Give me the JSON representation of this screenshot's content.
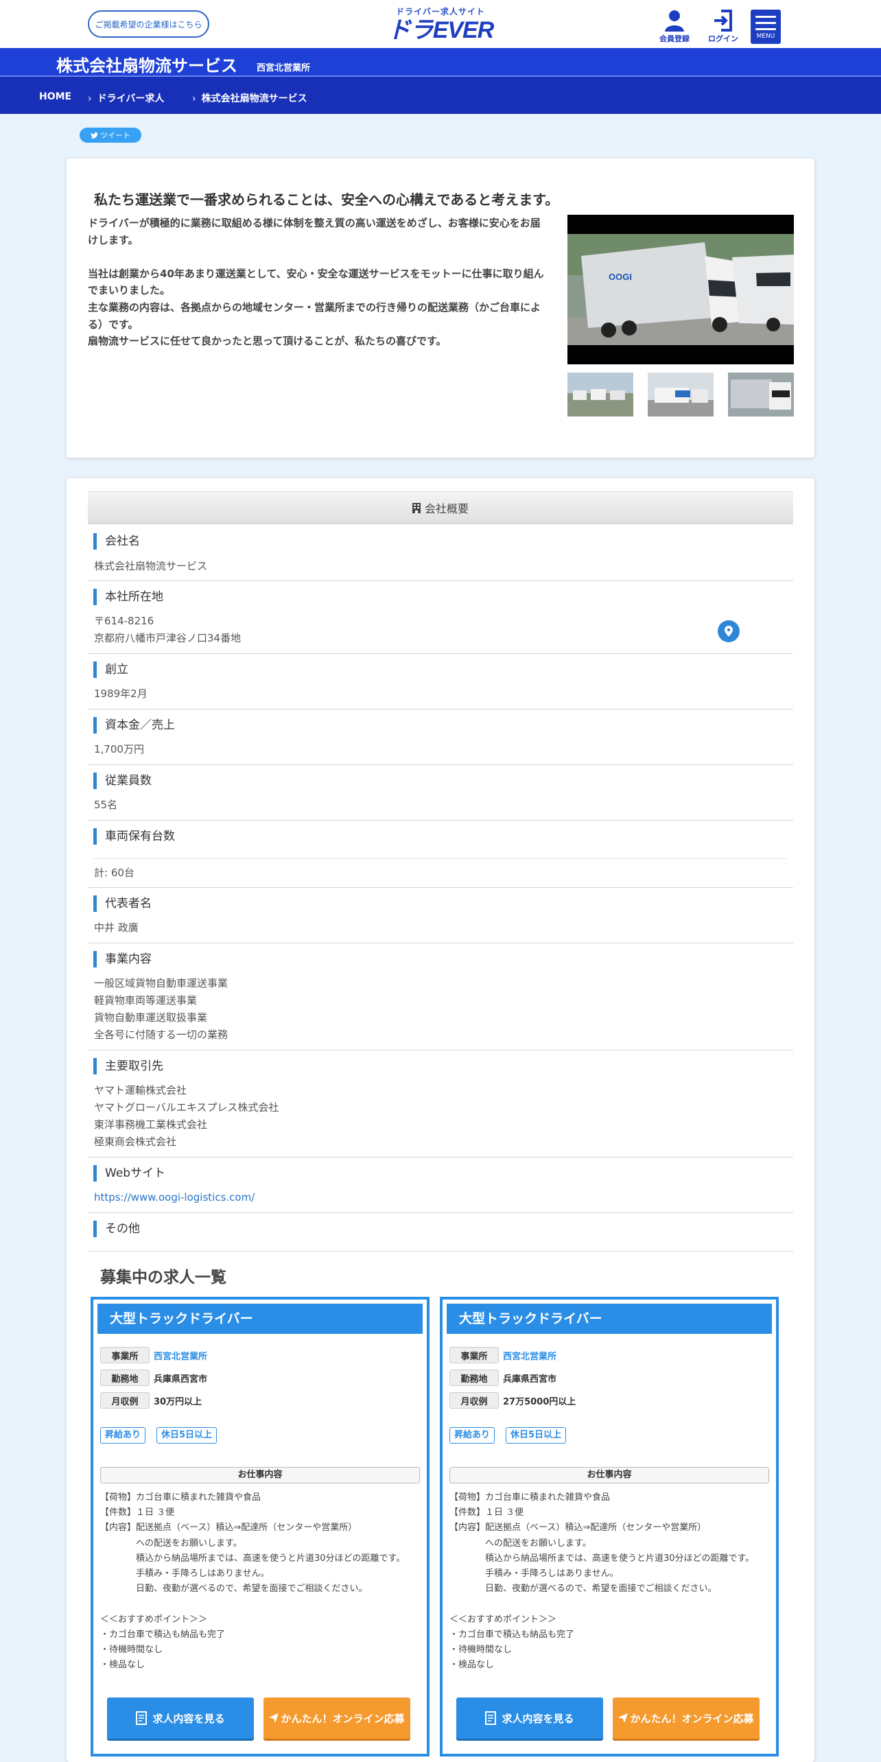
{
  "header": {
    "advertiser_link": "ご掲載希望の企業様はこちら",
    "logo_sub": "ドライバー求人サイト",
    "logo_main": "ドラEVER",
    "member_register": "会員登録",
    "login": "ログイン",
    "menu": "MENU"
  },
  "titlebar": {
    "company": "株式会社扇物流サービス",
    "branch": "西宮北営業所"
  },
  "breadcrumb": {
    "home": "HOME",
    "level1": "ドライバー求人",
    "level2": "株式会社扇物流サービス"
  },
  "tweet": "ツイート",
  "intro": {
    "heading": "私たち運送業で一番求められることは、安全への心構えであると考えます。",
    "body": "ドライバーが積極的に業務に取組める様に体制を整え質の高い運送をめざし、お客様に安心をお届けします。\n\n当社は創業から40年あまり運送業として、安心・安全な運送サービスをモットーに仕事に取り組んでまいりました。\n主な業務の内容は、各拠点からの地域センター・営業所までの行き帰りの配送業務（かご台車による）です。\n扇物流サービスに任せて良かったと思って頂けることが、私たちの喜びです。"
  },
  "overview": {
    "heading": "会社概要",
    "fields": [
      {
        "label": "会社名",
        "value": "株式会社扇物流サービス"
      },
      {
        "label": "本社所在地",
        "value": "〒614-8216\n京都府八幡市戸津谷ノ口34番地"
      },
      {
        "label": "創立",
        "value": "1989年2月"
      },
      {
        "label": "資本金／売上",
        "value": "1,700万円"
      },
      {
        "label": "従業員数",
        "value": "55名"
      },
      {
        "label": "車両保有台数",
        "value": "計: 60台"
      },
      {
        "label": "代表者名",
        "value": "中井 政廣"
      },
      {
        "label": "事業内容",
        "value": "一般区域貨物自動車運送事業\n軽貨物車両等運送事業\n貨物自動車運送取扱事業\n全各号に付随する一切の業務"
      },
      {
        "label": "主要取引先",
        "value": "ヤマト運輸株式会社\nヤマトグローバルエキスプレス株式会社\n東洋事務機工業株式会社\n極東商会株式会社"
      },
      {
        "label": "Webサイト",
        "value": "https://www.oogi-logistics.com/"
      },
      {
        "label": "その他",
        "value": ""
      }
    ]
  },
  "jobs": {
    "title": "募集中の求人一覧",
    "list": [
      {
        "title": "大型トラックドライバー",
        "office_label": "事業所",
        "office": "西宮北営業所",
        "location_label": "勤務地",
        "location": "兵庫県西宮市",
        "salary_label": "月収例",
        "salary": "30万円以上",
        "tags": [
          "昇給あり",
          "休日5日以上"
        ],
        "work_heading": "お仕事内容",
        "work_body": "【荷物】カゴ台車に積まれた雑貨や食品\n【件数】１日 ３便\n【内容】配送拠点（ベース）積込⇒配達所（センターや営業所）\n　　　　への配送をお願いします。\n　　　　積込から納品場所までは、高速を使うと片道30分ほどの距離です。\n　　　　手積み・手降ろしはありません。\n　　　　日勤、夜勤が選べるので、希望を面接でご相談ください。\n\n＜＜おすすめポイント＞＞\n・カゴ台車で積込も納品も完了\n・待機時間なし\n・検品なし",
        "detail_button": "求人内容を見る",
        "apply_button": "かんたん！オンライン応募"
      },
      {
        "title": "大型トラックドライバー",
        "office_label": "事業所",
        "office": "西宮北営業所",
        "location_label": "勤務地",
        "location": "兵庫県西宮市",
        "salary_label": "月収例",
        "salary": "27万5000円以上",
        "tags": [
          "昇給あり",
          "休日5日以上"
        ],
        "work_heading": "お仕事内容",
        "work_body": "【荷物】カゴ台車に積まれた雑貨や食品\n【件数】１日 ３便\n【内容】配送拠点（ベース）積込⇒配達所（センターや営業所）\n　　　　への配送をお願いします。\n　　　　積込から納品場所までは、高速を使うと片道30分ほどの距離です。\n　　　　手積み・手降ろしはありません。\n　　　　日勤、夜勤が選べるので、希望を面接でご相談ください。\n\n＜＜おすすめポイント＞＞\n・カゴ台車で積込も納品も完了\n・待機時間なし\n・検品なし",
        "detail_button": "求人内容を見る",
        "apply_button": "かんたん！オンライン応募"
      }
    ]
  },
  "colors": {
    "brand_blue": "#1e3ec2",
    "accent_blue": "#2b8ee6",
    "apply_orange": "#f59a2e",
    "page_bg": "#e9f3fc"
  }
}
